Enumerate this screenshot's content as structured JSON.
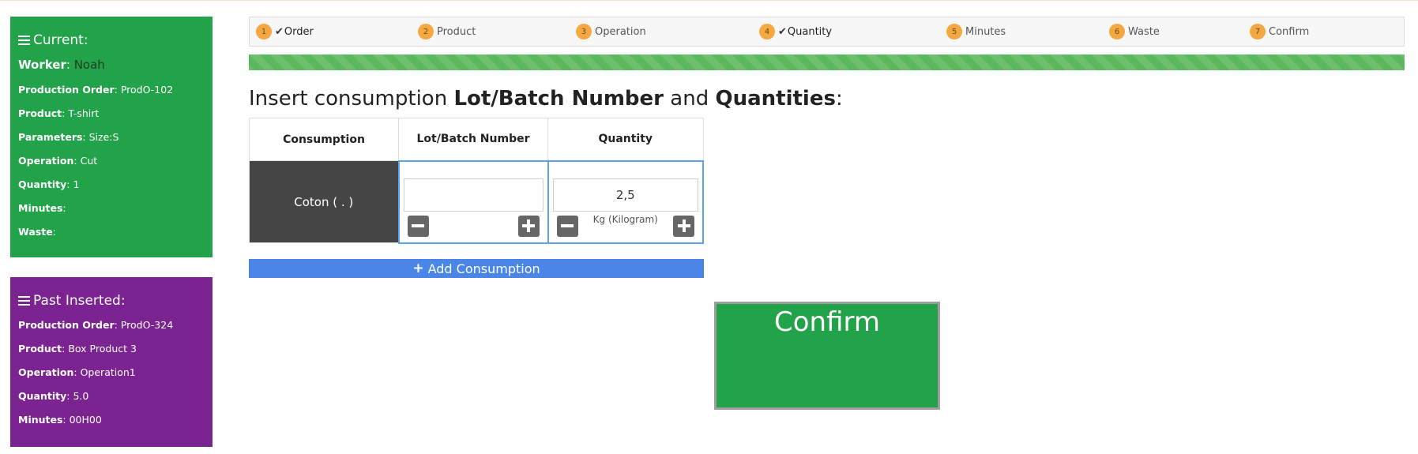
{
  "current": {
    "title": "Current:",
    "worker_label": "Worker",
    "worker_value": "Noah",
    "rows": [
      {
        "label": "Production Order",
        "value": "ProdO-102"
      },
      {
        "label": "Product",
        "value": "T-shirt"
      },
      {
        "label": "Parameters",
        "value": "Size:S"
      },
      {
        "label": "Operation",
        "value": "Cut"
      },
      {
        "label": "Quantity",
        "value": "1"
      },
      {
        "label": "Minutes",
        "value": ""
      },
      {
        "label": "Waste",
        "value": ""
      }
    ]
  },
  "past": {
    "title": "Past Inserted:",
    "rows": [
      {
        "label": "Production Order",
        "value": "ProdO-324"
      },
      {
        "label": "Product",
        "value": "Box Product 3"
      },
      {
        "label": "Operation",
        "value": "Operation1"
      },
      {
        "label": "Quantity",
        "value": "5.0"
      },
      {
        "label": "Minutes",
        "value": "00H00"
      }
    ]
  },
  "steps": [
    {
      "num": "1",
      "label": "Order",
      "done": true
    },
    {
      "num": "2",
      "label": "Product",
      "done": false
    },
    {
      "num": "3",
      "label": "Operation",
      "done": false
    },
    {
      "num": "4",
      "label": "Quantity",
      "done": true
    },
    {
      "num": "5",
      "label": "Minutes",
      "done": false
    },
    {
      "num": "6",
      "label": "Waste",
      "done": false
    },
    {
      "num": "7",
      "label": "Confirm",
      "done": false
    }
  ],
  "progress_fraction": 1.0,
  "heading": {
    "pre": "Insert consumption ",
    "bold1": "Lot/Batch Number",
    "mid": " and ",
    "bold2": "Quantities",
    "post": ":"
  },
  "table": {
    "headers": [
      "Consumption",
      "Lot/Batch Number",
      "Quantity"
    ],
    "row": {
      "consumption": "Coton ( . )",
      "lot_value": "",
      "lot_placeholder": "",
      "quantity_value": "2,5",
      "unit": "Kg (Kilogram)"
    }
  },
  "add_button": {
    "icon": "plus-icon",
    "label": "Add Consumption"
  },
  "confirm_button": {
    "label": "Confirm"
  },
  "colors": {
    "current_panel": "#22a34a",
    "past_panel": "#7b2390",
    "step_badge": "#f5a742",
    "progress": "#5cb85c",
    "add_button": "#4a86e8",
    "confirm_button": "#22a34a"
  }
}
